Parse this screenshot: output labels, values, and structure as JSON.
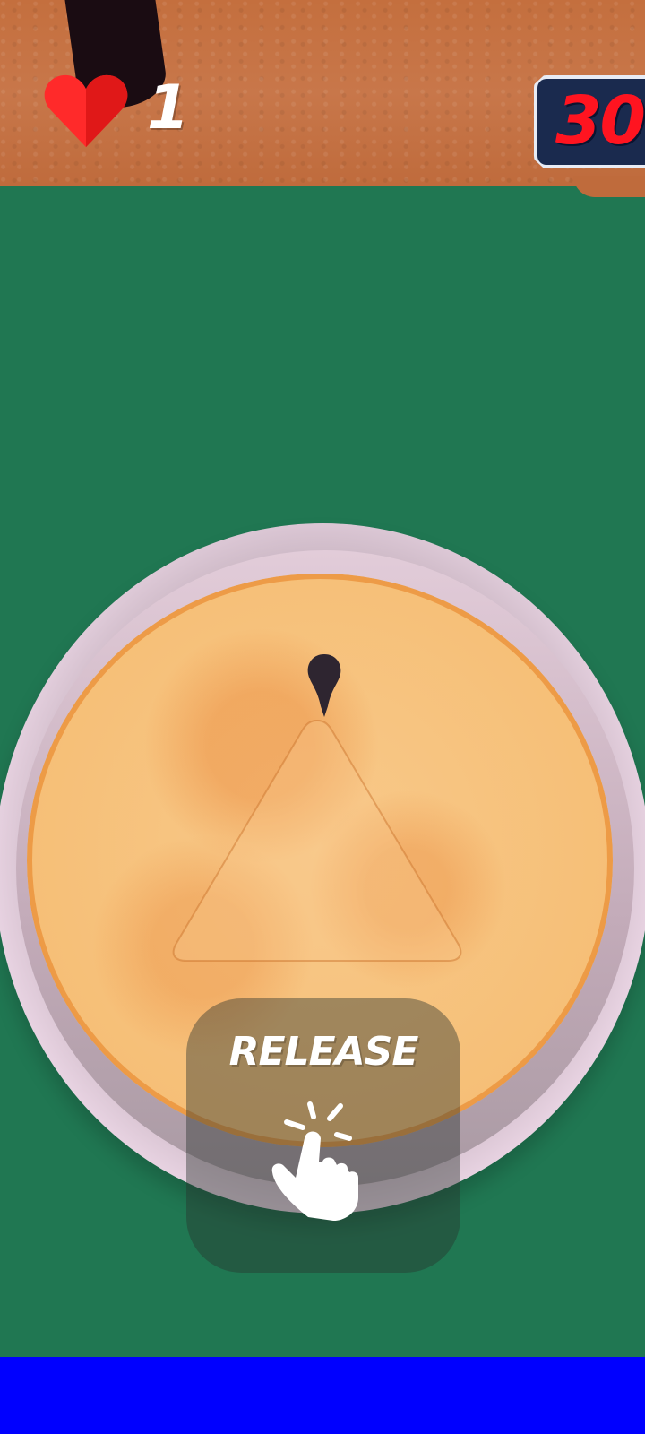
{
  "hud": {
    "lives_count": "1",
    "score": "30"
  },
  "prompt": {
    "label": "RELEASE"
  },
  "icons": {
    "lives": "heart-icon",
    "prompt": "tap-hand-icon"
  },
  "colors": {
    "table": "#207752",
    "counter_wood": "#c46f3e",
    "heart": "#ff2a2a",
    "score_text": "#ff1420",
    "score_box": "#1a2a4e",
    "bottom_bar": "#0000ff"
  }
}
